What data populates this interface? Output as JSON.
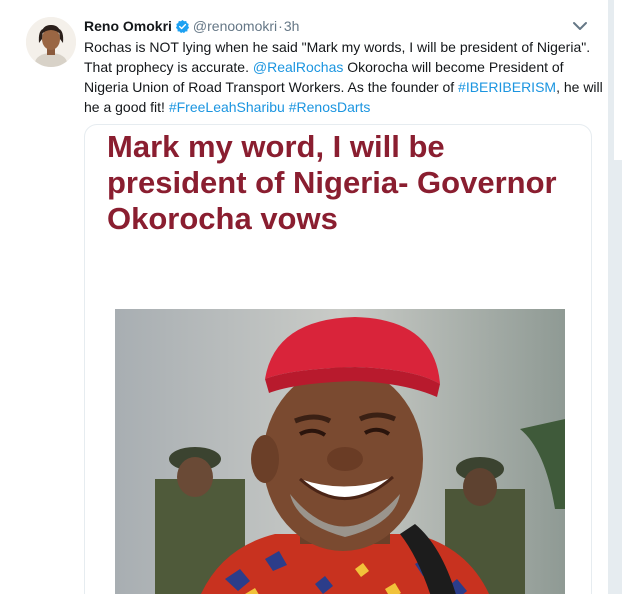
{
  "tweet": {
    "author_name": "Reno Omokri",
    "handle": "@renoomokri",
    "separator": "·",
    "time": "3h",
    "text_segments": [
      {
        "text": "Rochas is NOT lying when he said \"Mark my words, I will be president of Nigeria\". That prophecy is accurate. ",
        "link": false
      },
      {
        "text": "@RealRochas",
        "link": true
      },
      {
        "text": " Okorocha will become President of Nigeria Union of Road Transport Workers. As the founder of ",
        "link": false
      },
      {
        "text": "#IBERIBERISM",
        "link": true
      },
      {
        "text": ", he will he a good fit! ",
        "link": false
      },
      {
        "text": "#FreeLeahSharibu",
        "link": true
      },
      {
        "text": " ",
        "link": false
      },
      {
        "text": "#RenosDarts",
        "link": true
      }
    ]
  },
  "card": {
    "headline": "Mark my word, I will be president of Nigeria- Governor Okorocha vows"
  },
  "icons": {
    "avatar": "author-avatar",
    "verified": "verified-badge-icon",
    "caret": "chevron-down-icon"
  },
  "colors": {
    "link": "#1b95e0",
    "headline": "#8a1e30",
    "verified": "#1da1f2",
    "secondary_text": "#657786",
    "cap": "#d9243a"
  }
}
